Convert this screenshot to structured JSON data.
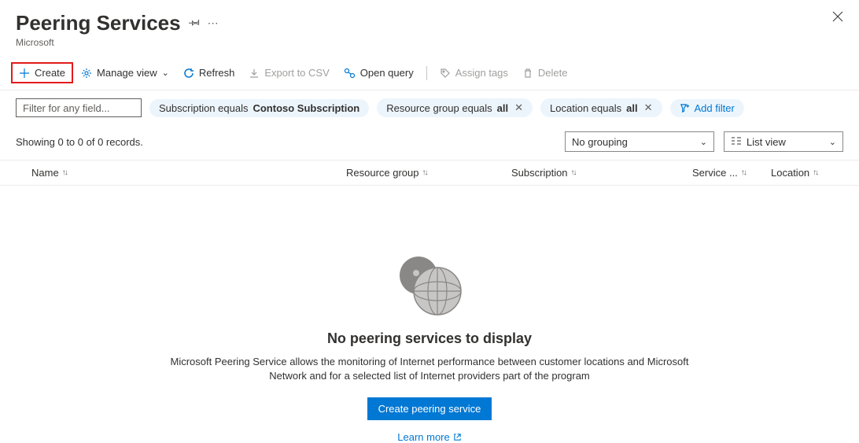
{
  "header": {
    "title": "Peering Services",
    "subtitle": "Microsoft"
  },
  "toolbar": {
    "create": "Create",
    "manage_view": "Manage view",
    "refresh": "Refresh",
    "export_csv": "Export to CSV",
    "open_query": "Open query",
    "assign_tags": "Assign tags",
    "delete": "Delete"
  },
  "filters": {
    "input_placeholder": "Filter for any field...",
    "subscription_prefix": "Subscription equals ",
    "subscription_value": "Contoso Subscription",
    "rg_prefix": "Resource group equals ",
    "rg_value": "all",
    "loc_prefix": "Location equals ",
    "loc_value": "all",
    "add_filter": "Add filter"
  },
  "status": {
    "records": "Showing 0 to 0 of 0 records.",
    "grouping": "No grouping",
    "view": "List view"
  },
  "columns": {
    "name": "Name",
    "rg": "Resource group",
    "sub": "Subscription",
    "svc": "Service ...",
    "loc": "Location"
  },
  "empty": {
    "title": "No peering services to display",
    "desc": "Microsoft Peering Service allows the monitoring of Internet performance between customer locations and Microsoft Network and for a selected list of Internet providers part of the program",
    "button": "Create peering service",
    "learn": "Learn more"
  }
}
